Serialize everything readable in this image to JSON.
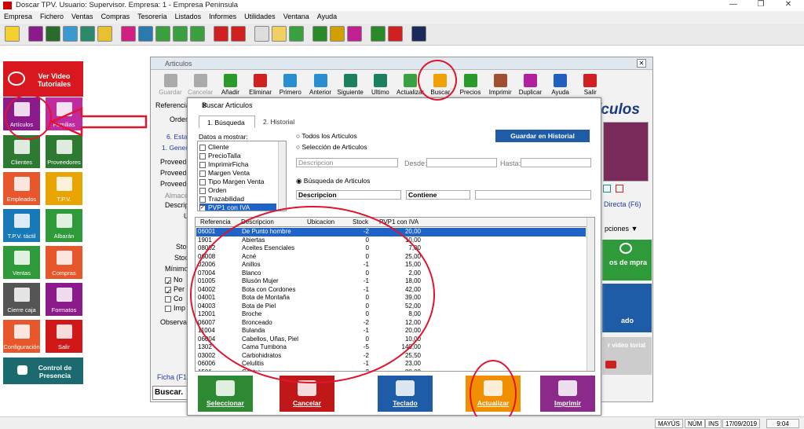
{
  "app": {
    "title": "Doscar TPV. Usuario: Supervisor. Empresa: 1 - Empresa Peninsula"
  },
  "menu": [
    "Empresa",
    "Fichero",
    "Ventas",
    "Compras",
    "Tesorería",
    "Listados",
    "Informes",
    "Utilidades",
    "Ventana",
    "Ayuda"
  ],
  "sidebar": {
    "video": "Ver Video Tutoriales",
    "items": [
      {
        "label": "Artículos",
        "color": "#8b1a8b"
      },
      {
        "label": "Familias",
        "color": "#c02ca0"
      },
      {
        "label": "Clientes",
        "color": "#2e7a32"
      },
      {
        "label": "Proveedores",
        "color": "#2e7a32"
      },
      {
        "label": "Empleados",
        "color": "#e8572c"
      },
      {
        "label": "T.P.V.",
        "color": "#e8a400"
      },
      {
        "label": "T.P.V. táctil",
        "color": "#1879b8"
      },
      {
        "label": "Albarán",
        "color": "#2e9a3a"
      },
      {
        "label": "Ventas",
        "color": "#2e9a3a"
      },
      {
        "label": "Compras",
        "color": "#e8572c"
      },
      {
        "label": "Cierre caja",
        "color": "#555555"
      },
      {
        "label": "Formatos",
        "color": "#8b1a8b"
      },
      {
        "label": "Configuración",
        "color": "#e8572c"
      },
      {
        "label": "Salir",
        "color": "#d01818"
      }
    ],
    "presence": "Control de Presencia"
  },
  "main": {
    "title": "Articulos",
    "toolbar": [
      {
        "label": "Guardar",
        "color": "#aaaaaa",
        "enabled": false
      },
      {
        "label": "Cancelar",
        "color": "#aaaaaa",
        "enabled": false
      },
      {
        "label": "Añadir",
        "color": "#2a9a2a",
        "enabled": true
      },
      {
        "label": "Eliminar",
        "color": "#d02020",
        "enabled": true
      },
      {
        "label": "Primero",
        "color": "#2a8fd0",
        "enabled": true
      },
      {
        "label": "Anterior",
        "color": "#2a8fd0",
        "enabled": true
      },
      {
        "label": "Siguiente",
        "color": "#1a8060",
        "enabled": true
      },
      {
        "label": "Ultimo",
        "color": "#1a8060",
        "enabled": true
      },
      {
        "label": "Actualizar",
        "color": "#3aa040",
        "enabled": true
      },
      {
        "label": "Buscar",
        "color": "#f0a000",
        "enabled": true
      },
      {
        "label": "Precios",
        "color": "#2a9a2a",
        "enabled": true
      },
      {
        "label": "Imprimir",
        "color": "#a05030",
        "enabled": true
      },
      {
        "label": "Duplicar",
        "color": "#b020a0",
        "enabled": true
      },
      {
        "label": "Ayuda",
        "color": "#2060c0",
        "enabled": true
      },
      {
        "label": "Salir",
        "color": "#d02020",
        "enabled": true
      }
    ],
    "referencia": "Referencia",
    "orden": "Orden:",
    "tab1": "6. Estad",
    "tab2": "1. Genera",
    "prov": [
      "Proveedo",
      "Proveedo",
      "Proveedo"
    ],
    "almacen": "Almacé",
    "descrip": "Descrip",
    "u": "U",
    "stoc1": "Stoc",
    "stoc2": "Stock",
    "minimo": "Mínimo",
    "checks": [
      "No",
      "Per",
      "Co",
      "Imp"
    ],
    "observ": "Observacio",
    "ficha": "Ficha (F11)",
    "buscar": "Buscar.",
    "right_title": "ículos",
    "directa": "Directa (F6)",
    "opciones": "pciones",
    "compra": "os de mpra",
    "teclado": "ado",
    "video": "r video torial"
  },
  "dialog": {
    "title": "Buscar Articulos",
    "tabs": [
      "1. Búsqueda",
      "2. Historial"
    ],
    "datos_label": "Datos a mostrar:",
    "datos": [
      {
        "label": "Cliente",
        "checked": false
      },
      {
        "label": "PrecioTalla",
        "checked": false
      },
      {
        "label": "ImprimirFicha",
        "checked": false
      },
      {
        "label": "Margen Venta",
        "checked": false
      },
      {
        "label": "Tipo Margen Venta",
        "checked": false
      },
      {
        "label": "Orden",
        "checked": false
      },
      {
        "label": "Trazabilidad",
        "checked": false
      },
      {
        "label": "PVP1 con IVA",
        "checked": true
      }
    ],
    "radio_todos": "Todos los Articulos",
    "radio_sel": "Selección de Articulos",
    "sel_field": "Descripcion",
    "desde": "Desde:",
    "hasta": "Hasta:",
    "guardar_hist": "Guardar en Historial",
    "radio_busq": "Búsqueda de Articulos",
    "busq_field": "Descripcion",
    "busq_op": "Contiene",
    "columns": [
      "Referencia",
      "Descripcion",
      "Ubicacion",
      "Stock",
      "PVP1 con IVA"
    ],
    "rows": [
      [
        "06001",
        "De Punto hombre",
        "",
        "-2",
        "20,00"
      ],
      [
        "1901",
        "Abiertas",
        "",
        "0",
        "10,00"
      ],
      [
        "08002",
        "Aceites Esenciales",
        "",
        "0",
        "7,00"
      ],
      [
        "06008",
        "Acné",
        "",
        "0",
        "25,00"
      ],
      [
        "02006",
        "Anillos",
        "",
        "-1",
        "15,00"
      ],
      [
        "07004",
        "Blanco",
        "",
        "0",
        "2,00"
      ],
      [
        "01005",
        "Blusón Mujer",
        "",
        "-1",
        "18,00"
      ],
      [
        "04002",
        "Bota con Cordones",
        "",
        "-1",
        "42,00"
      ],
      [
        "04001",
        "Bota de Montaña",
        "",
        "0",
        "39,00"
      ],
      [
        "04003",
        "Bota de Piel",
        "",
        "0",
        "52,00"
      ],
      [
        "12001",
        "Broche",
        "",
        "0",
        "8,00"
      ],
      [
        "06007",
        "Bronceado",
        "",
        "-2",
        "12,00"
      ],
      [
        "11004",
        "Bulanda",
        "",
        "-1",
        "20,00"
      ],
      [
        "06004",
        "Cabellos, Uñas, Piel",
        "",
        "0",
        "10,00"
      ],
      [
        "1302",
        "Cama Tumbona",
        "",
        "-5",
        "140,00"
      ],
      [
        "03002",
        "Carbohidratos",
        "",
        "-2",
        "25,50"
      ],
      [
        "06006",
        "Celulitis",
        "",
        "-1",
        "23,00"
      ],
      [
        "1501",
        "Centro",
        "",
        "-2",
        "80,00"
      ]
    ],
    "buttons": [
      {
        "label": "Seleccionar",
        "color": "#2e8a32"
      },
      {
        "label": "Cancelar",
        "color": "#c01818"
      },
      {
        "label": "Teclado",
        "color": "#1f5ca8"
      },
      {
        "label": "Actualizar",
        "color": "#f09000"
      },
      {
        "label": "Imprimir",
        "color": "#8b2a8b"
      }
    ]
  },
  "status": {
    "mayus": "MAYÚS",
    "num": "NÚM",
    "ins": "INS",
    "date": "17/09/2019",
    "time": "9:04"
  }
}
